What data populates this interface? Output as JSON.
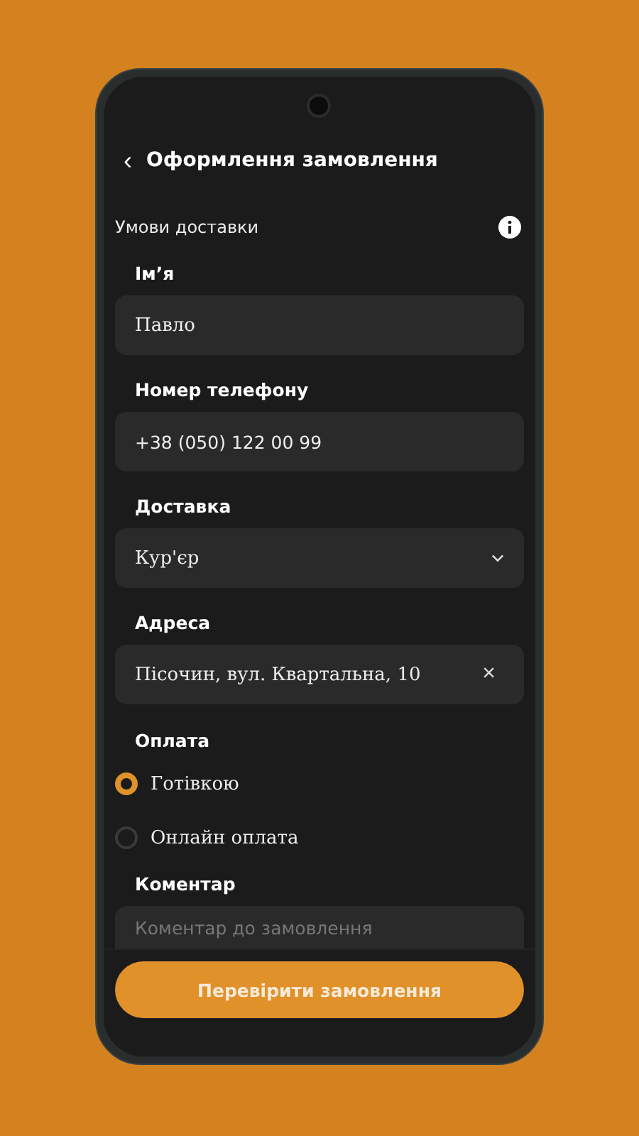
{
  "header": {
    "back": "‹",
    "title": "Оформлення замовлення"
  },
  "section": {
    "title": "Умови доставки"
  },
  "fields": [
    {
      "label": "Ім’я",
      "kind": "text",
      "value": "Павло"
    },
    {
      "label": "Номер телефону",
      "kind": "phone",
      "value": "+38 (050) 122 00 99"
    },
    {
      "label": "Доставка",
      "kind": "select",
      "value": "Кур'єр"
    },
    {
      "label": "Адреса",
      "kind": "clearable",
      "value": "Пісочин, вул. Квартальна, 10",
      "clear": "×"
    }
  ],
  "payment": {
    "label": "Оплата",
    "options": [
      {
        "label": "Готівкою",
        "selected": true
      },
      {
        "label": "Онлайн оплата",
        "selected": false
      }
    ]
  },
  "comment": {
    "label": "Коментар",
    "placeholder": "Коментар до замовлення"
  },
  "submit": "Перевірити замовлення"
}
